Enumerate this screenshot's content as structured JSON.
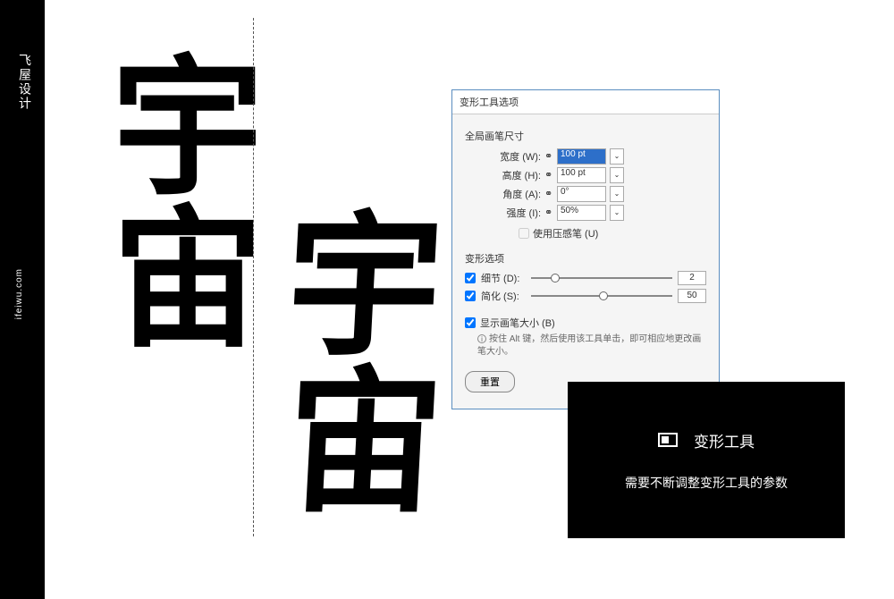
{
  "sidebar": {
    "brand": "飞屋设计",
    "url": "ifeiwu.com"
  },
  "calligraphy": {
    "char1": "宇",
    "char2": "宙",
    "char3": "宇",
    "char4": "宙"
  },
  "dialog": {
    "title": "变形工具选项",
    "section_brush": "全局画笔尺寸",
    "width_label": "宽度 (W):",
    "width_value": "100 pt",
    "height_label": "高度 (H):",
    "height_value": "100 pt",
    "angle_label": "角度 (A):",
    "angle_value": "0°",
    "intensity_label": "强度 (I):",
    "intensity_value": "50%",
    "pressure_label": "使用压感笔 (U)",
    "section_warp": "变形选项",
    "detail_label": "细节 (D):",
    "detail_value": "2",
    "simplify_label": "简化 (S):",
    "simplify_value": "50",
    "show_brush_label": "显示画笔大小 (B)",
    "tip": "按住 Alt 键，然后使用该工具单击，即可相应地更改画笔大小。",
    "reset": "重置"
  },
  "panel": {
    "tool_name": "变形工具",
    "desc": "需要不断调整变形工具的参数"
  }
}
